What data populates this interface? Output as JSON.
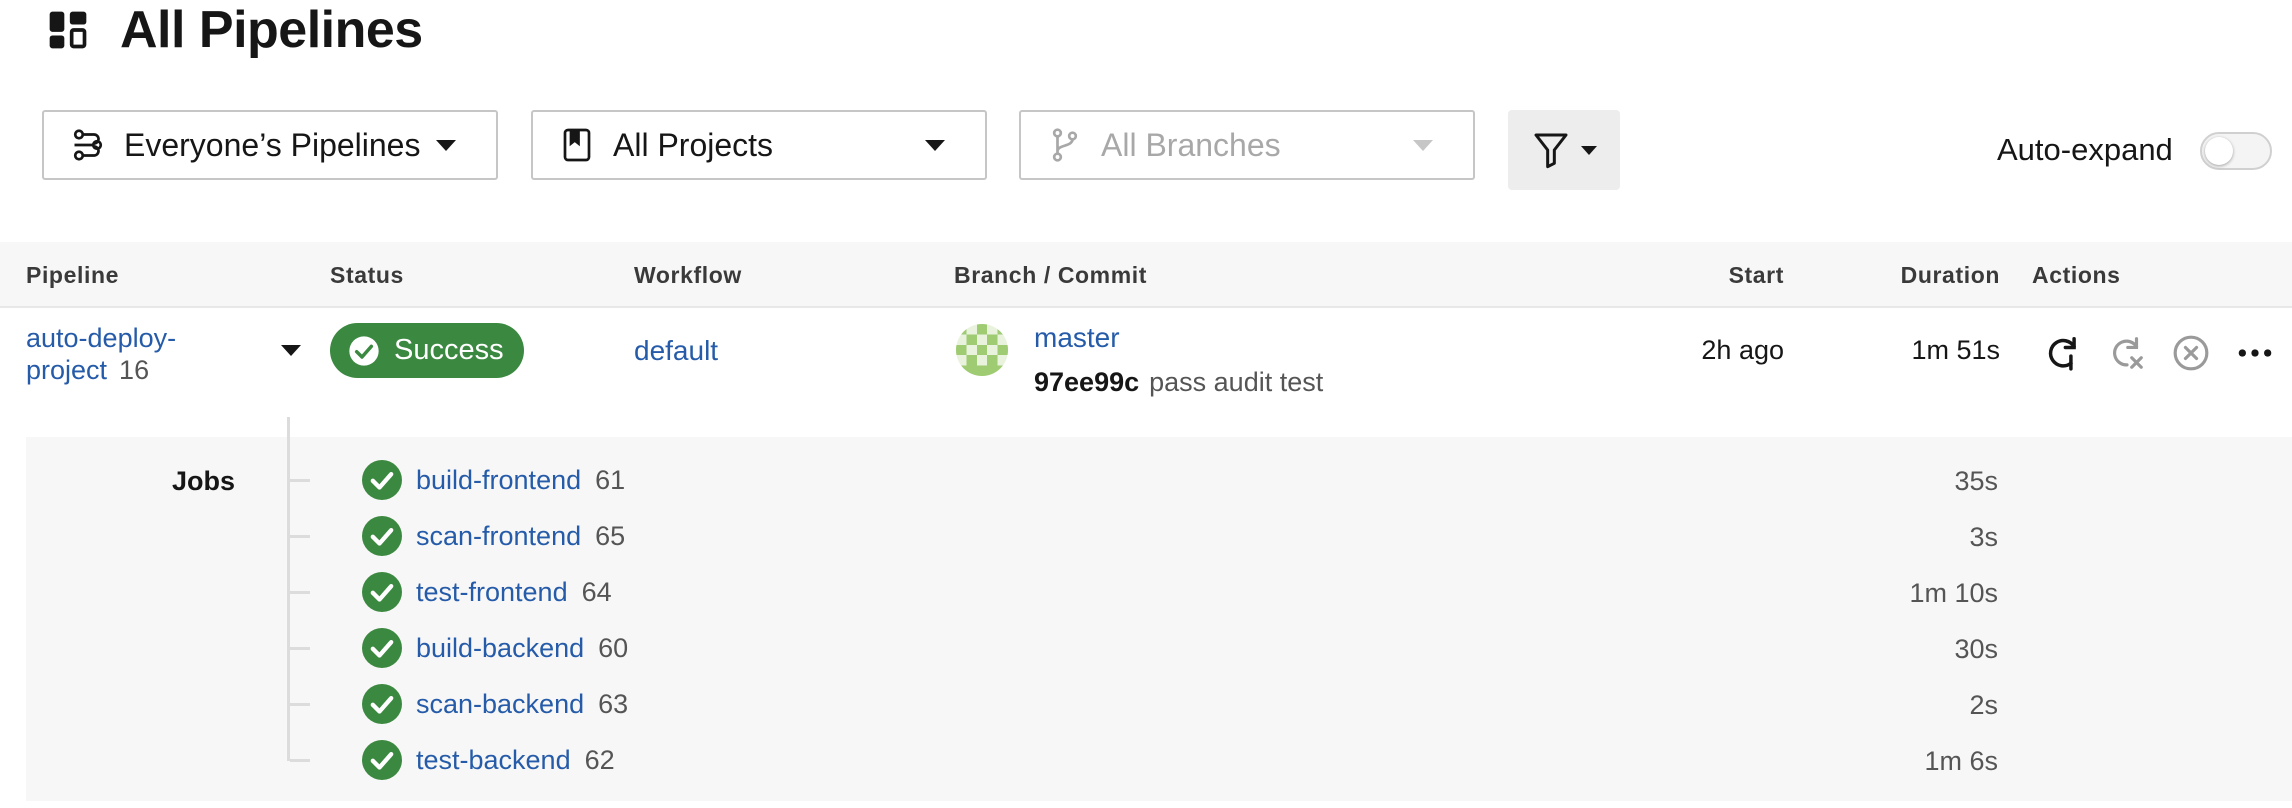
{
  "header": {
    "title": "All Pipelines",
    "icon": "dashboard-icon"
  },
  "filters": {
    "pipelines": {
      "label": "Everyone’s Pipelines",
      "icon": "people-icon"
    },
    "projects": {
      "label": "All Projects",
      "icon": "bookmark-icon"
    },
    "branches": {
      "label": "All Branches",
      "icon": "branch-icon"
    },
    "filter_button_icon": "filter-icon",
    "auto_expand_label": "Auto-expand",
    "auto_expand_on": false
  },
  "table": {
    "columns": [
      "Pipeline",
      "Status",
      "Workflow",
      "Branch / Commit",
      "Start",
      "Duration",
      "Actions"
    ]
  },
  "pipeline": {
    "name_line1": "auto-deploy-",
    "name_line2": "project",
    "number": "16",
    "status": "Success",
    "workflow": "default",
    "branch": "master",
    "commit_hash": "97ee99c",
    "commit_message": "pass audit test",
    "start": "2h ago",
    "duration": "1m 51s",
    "actions": [
      "rerun-icon",
      "rerun-failed-icon",
      "cancel-icon",
      "more-icon"
    ]
  },
  "jobs": {
    "label": "Jobs",
    "items": [
      {
        "name": "build-frontend",
        "number": "61",
        "duration": "35s"
      },
      {
        "name": "scan-frontend",
        "number": "65",
        "duration": "3s"
      },
      {
        "name": "test-frontend",
        "number": "64",
        "duration": "1m 10s"
      },
      {
        "name": "build-backend",
        "number": "60",
        "duration": "30s"
      },
      {
        "name": "scan-backend",
        "number": "63",
        "duration": "2s"
      },
      {
        "name": "test-backend",
        "number": "62",
        "duration": "1m 6s"
      }
    ]
  },
  "colors": {
    "success": "#3b8940",
    "link": "#255ba8"
  }
}
